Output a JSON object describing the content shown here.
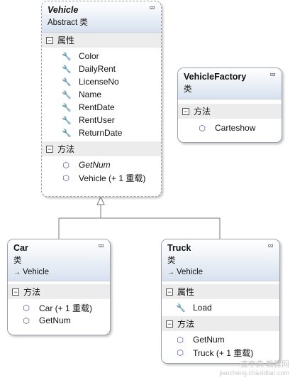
{
  "vehicle": {
    "name": "Vehicle",
    "subtitle": "Abstract 类",
    "sections": [
      {
        "title": "属性",
        "members": [
          "Color",
          "DailyRent",
          "LicenseNo",
          "Name",
          "RentDate",
          "RentUser",
          "ReturnDate"
        ]
      },
      {
        "title": "方法",
        "members": [
          "GetNum",
          "Vehicle (+ 1 重载)"
        ]
      }
    ]
  },
  "factory": {
    "name": "VehicleFactory",
    "subtitle": "类",
    "sections": [
      {
        "title": "方法",
        "members": [
          "Carteshow"
        ]
      }
    ]
  },
  "car": {
    "name": "Car",
    "subtitle": "类",
    "base": "Vehicle",
    "sections": [
      {
        "title": "方法",
        "members": [
          "Car (+ 1 重载)",
          "GetNum"
        ]
      }
    ]
  },
  "truck": {
    "name": "Truck",
    "subtitle": "类",
    "base": "Vehicle",
    "sections": [
      {
        "title": "属性",
        "members": [
          "Load"
        ]
      },
      {
        "title": "方法",
        "members": [
          "GetNum",
          "Truck (+ 1 重载)"
        ]
      }
    ]
  },
  "icons": {
    "collapse": "double-chevron-up-icon",
    "property": "wrench-icon",
    "method": "cube-icon",
    "inherit": "arrow-right-icon"
  },
  "watermark": {
    "line1": "查字典 教程网",
    "line2": "jiaocheng.chazidian.com"
  }
}
